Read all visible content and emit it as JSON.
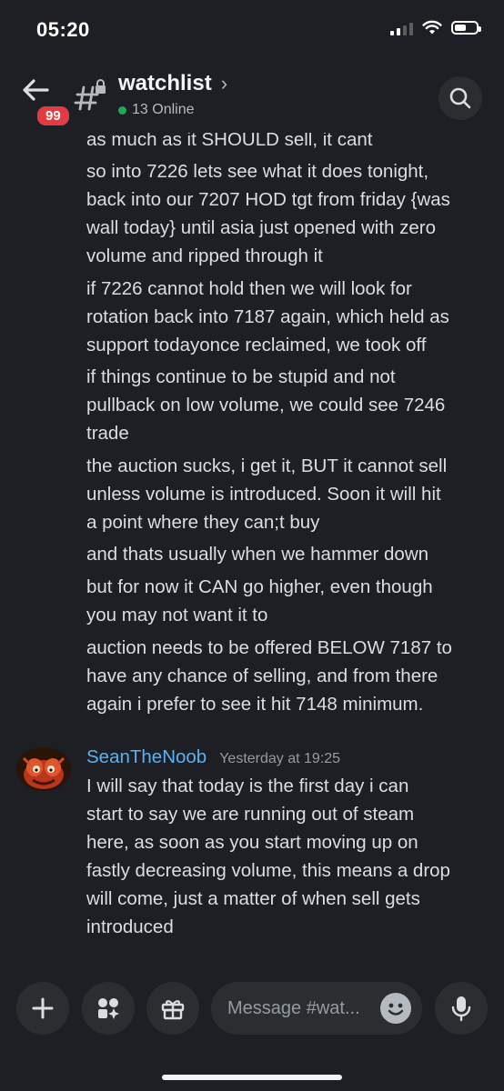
{
  "status": {
    "time": "05:20"
  },
  "header": {
    "back_badge": "99",
    "channel_name": "watchlist",
    "chevron": "›",
    "online_text": "13 Online"
  },
  "messages": {
    "continued_lines": [
      "as much as it SHOULD sell, it cant",
      "so into 7226 lets see what it does tonight,",
      "back into our 7207 HOD tgt from friday {was",
      "wall today} until asia just opened with zero",
      "volume and ripped through it",
      "if 7226 cannot hold then we will look for",
      "rotation back into 7187 again, which held as",
      "support todayonce reclaimed, we took off",
      "if things continue to be stupid and not",
      "pullback on low volume, we could see 7246",
      "trade",
      "the auction sucks, i get it, BUT it cannot sell",
      "unless volume is introduced.  Soon it will hit",
      "a point where they can;t buy",
      "and thats usually when we hammer down",
      "but for now it CAN go higher, even though",
      "you may not want it to",
      "auction needs to be offered BELOW 7187 to",
      "have any chance of selling, and from there",
      "again i prefer to see it hit 7148 minimum."
    ],
    "last": {
      "author": "SeanTheNoob",
      "timestamp": "Yesterday at 19:25",
      "lines": [
        "I will say that today is the first day i can",
        "start to say we are running out of steam",
        "here, as soon as you start moving up on",
        "fastly decreasing volume, this means a drop",
        "will come, just a matter of when sell gets",
        "introduced"
      ]
    }
  },
  "composer": {
    "placeholder": "Message #wat..."
  },
  "icons": {
    "back": "arrow-left-icon",
    "channel": "hashtag-lock-icon",
    "search": "search-icon",
    "add": "plus-icon",
    "apps": "apps-icon",
    "gift": "gift-icon",
    "emoji": "emoji-icon",
    "mic": "microphone-icon"
  },
  "colors": {
    "background": "#1e1f24",
    "username": "#5ab2f0",
    "badge": "#e23c43",
    "online_dot": "#23a55a"
  }
}
